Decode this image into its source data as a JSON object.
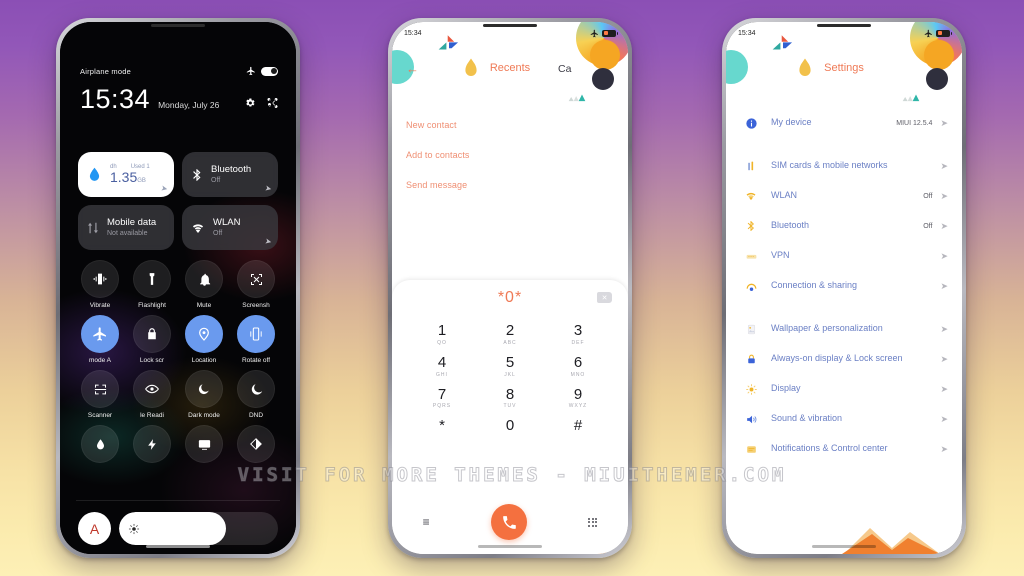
{
  "background": {
    "top_color": "#8b4fb5",
    "bottom_color": "#fdf0b6"
  },
  "watermark": {
    "text": "VISIT FOR MORE THEMES - MIUITHEMER.COM"
  },
  "phone_control_center": {
    "status": {
      "airplane_label": "Airplane mode",
      "airplane_icon": "airplane-icon",
      "toggle_state": "on"
    },
    "clock": {
      "time": "15:34",
      "date": "Monday, July 26"
    },
    "header_icons": [
      {
        "name": "settings-gear-icon",
        "glyph": "⚙"
      },
      {
        "name": "edit-scissors-icon",
        "glyph": "✂"
      }
    ],
    "cards": [
      {
        "name": "mobile-data-usage",
        "icon": "water-drop-icon",
        "top_left": "dh",
        "top_right": "Used 1",
        "value": "1.35",
        "unit": "GB",
        "style": "light"
      },
      {
        "name": "bluetooth",
        "icon": "bluetooth-icon",
        "title": "Bluetooth",
        "subtitle": "Off",
        "style": "dark"
      },
      {
        "name": "mobile-data",
        "icon": "data-arrows-icon",
        "title": "Mobile data",
        "subtitle": "Not available",
        "style": "dark"
      },
      {
        "name": "wlan",
        "icon": "wifi-icon",
        "title": "WLAN",
        "subtitle": "Off",
        "style": "dark"
      }
    ],
    "tiles": [
      {
        "label": "Vibrate",
        "icon": "vibrate-icon",
        "on": false
      },
      {
        "label": "Flashlight",
        "icon": "flashlight-icon",
        "on": false
      },
      {
        "label": "Mute",
        "icon": "bell-icon",
        "on": false
      },
      {
        "label": "Screensh",
        "icon": "screenshot-icon",
        "on": false
      },
      {
        "label": "mode      A",
        "icon": "airplane-icon",
        "on": true
      },
      {
        "label": "Lock scr",
        "icon": "lock-icon",
        "on": false
      },
      {
        "label": "Location",
        "icon": "location-pin-icon",
        "on": true
      },
      {
        "label": "Rotate off",
        "icon": "rotate-icon",
        "on": true
      },
      {
        "label": "Scanner",
        "icon": "scan-frame-icon",
        "on": false
      },
      {
        "label": "le    Readi",
        "icon": "eye-icon",
        "on": false
      },
      {
        "label": "Dark mode",
        "icon": "moon-icon",
        "on": false
      },
      {
        "label": "DND",
        "icon": "crescent-moon-icon",
        "on": false
      },
      {
        "label": "",
        "icon": "water-drop-icon",
        "on": false
      },
      {
        "label": "",
        "icon": "lightning-bolt-icon",
        "on": false
      },
      {
        "label": "",
        "icon": "cast-screen-icon",
        "on": false
      },
      {
        "label": "",
        "icon": "contrast-icon",
        "on": false
      }
    ],
    "brightness": {
      "auto_label": "A",
      "icon": "sun-brightness-icon",
      "level_percent": 67
    }
  },
  "phone_dialer": {
    "status": {
      "time": "15:34"
    },
    "header": {
      "back_icon": "back-arrow-icon",
      "title": "Recents",
      "tab2": "Ca"
    },
    "menu": [
      {
        "label": "New contact"
      },
      {
        "label": "Add to contacts"
      },
      {
        "label": "Send message"
      }
    ],
    "dialpad": {
      "entered_number": "*0*",
      "backspace_icon": "backspace-icon",
      "keys": [
        {
          "digit": "1",
          "letters": "QO"
        },
        {
          "digit": "2",
          "letters": "ABC"
        },
        {
          "digit": "3",
          "letters": "DEF"
        },
        {
          "digit": "4",
          "letters": "GHI"
        },
        {
          "digit": "5",
          "letters": "JKL"
        },
        {
          "digit": "6",
          "letters": "MNO"
        },
        {
          "digit": "7",
          "letters": "PQRS"
        },
        {
          "digit": "8",
          "letters": "TUV"
        },
        {
          "digit": "9",
          "letters": "WXYZ"
        },
        {
          "digit": "*",
          "letters": ""
        },
        {
          "digit": "0",
          "letters": ""
        },
        {
          "digit": "#",
          "letters": ""
        }
      ],
      "actions": [
        {
          "name": "menu-lines-icon",
          "glyph": "≡"
        },
        {
          "name": "call-button",
          "glyph": "☎"
        },
        {
          "name": "keypad-dots-icon",
          "glyph": ""
        }
      ]
    }
  },
  "phone_settings": {
    "status": {
      "time": "15:34"
    },
    "header": {
      "title": "Settings"
    },
    "rows": [
      {
        "icon": "info-circle-icon",
        "label": "My device",
        "value": "MIUI 12.5.4",
        "gap_after": true
      },
      {
        "icon": "sim-card-icon",
        "label": "SIM cards & mobile networks",
        "value": ""
      },
      {
        "icon": "wifi-icon",
        "label": "WLAN",
        "value": "Off"
      },
      {
        "icon": "bluetooth-icon",
        "label": "Bluetooth",
        "value": "Off"
      },
      {
        "icon": "vpn-icon",
        "label": "VPN",
        "value": ""
      },
      {
        "icon": "connection-sharing-icon",
        "label": "Connection & sharing",
        "value": "",
        "gap_after": true
      },
      {
        "icon": "wallpaper-icon",
        "label": "Wallpaper & personalization",
        "value": ""
      },
      {
        "icon": "lock-screen-icon",
        "label": "Always-on display & Lock screen",
        "value": ""
      },
      {
        "icon": "display-brightness-icon",
        "label": "Display",
        "value": ""
      },
      {
        "icon": "sound-icon",
        "label": "Sound & vibration",
        "value": ""
      },
      {
        "icon": "notifications-icon",
        "label": "Notifications & Control center",
        "value": ""
      }
    ]
  }
}
